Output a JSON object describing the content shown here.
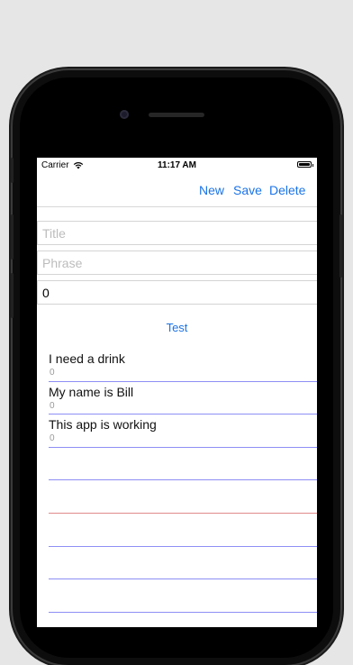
{
  "status_bar": {
    "carrier": "Carrier",
    "time": "11:17 AM"
  },
  "toolbar": {
    "new_label": "New",
    "save_label": "Save",
    "delete_label": "Delete"
  },
  "form": {
    "title_placeholder": "Title",
    "title_value": "",
    "phrase_placeholder": "Phrase",
    "phrase_value": "",
    "number_value": "0"
  },
  "test_label": "Test",
  "phrases": [
    {
      "text": "I need a drink",
      "count": "0"
    },
    {
      "text": "My name is Bill",
      "count": "0"
    },
    {
      "text": "This app is working",
      "count": "0"
    }
  ],
  "colors": {
    "accent": "#1a73e8",
    "row_line": "#8e8ef5",
    "row_line_alt": "#e08a8a"
  }
}
